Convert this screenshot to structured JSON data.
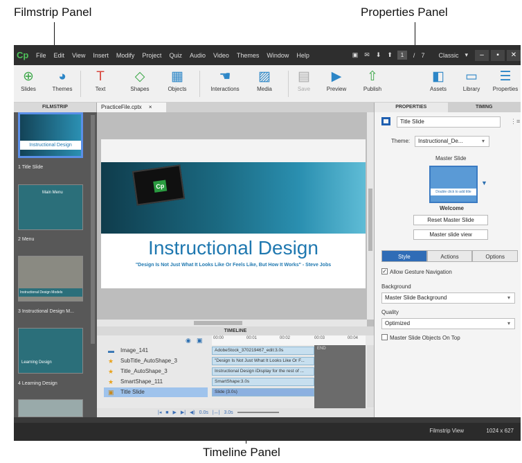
{
  "callouts": {
    "filmstrip": "Filmstrip Panel",
    "properties": "Properties Panel",
    "timeline": "Timeline Panel"
  },
  "menubar": {
    "logo": "Cp",
    "items": [
      "File",
      "Edit",
      "View",
      "Insert",
      "Modify",
      "Project",
      "Quiz",
      "Audio",
      "Video",
      "Themes",
      "Window",
      "Help"
    ],
    "page_current": "1",
    "page_sep": "/",
    "page_total": "7",
    "workspace": "Classic",
    "workspace_icon": "dropdown-icon"
  },
  "toolbar": {
    "slides": "Slides",
    "themes": "Themes",
    "text": "Text",
    "shapes": "Shapes",
    "objects": "Objects",
    "interactions": "Interactions",
    "media": "Media",
    "save": "Save",
    "preview": "Preview",
    "publish": "Publish",
    "assets": "Assets",
    "library": "Library",
    "properties": "Properties"
  },
  "filmstrip": {
    "header": "FILMSTRIP",
    "slides": [
      {
        "label": "1 Title Slide",
        "thumb_text": "Instructional Design"
      },
      {
        "label": "2 Menu",
        "thumb_text": "Main Menu"
      },
      {
        "label": "3 Instructional Design M...",
        "thumb_text": "Instructional Design Models"
      },
      {
        "label": "4 Learning Design",
        "thumb_text": "Learning Design"
      }
    ]
  },
  "document": {
    "tab": "PracticeFile.cptx",
    "close": "×"
  },
  "slide": {
    "logo": "Cp",
    "title": "Instructional Design",
    "subtitle": "\"Design Is Not Just What It Looks Like Or Feels Like, But How It Works\" - Steve Jobs"
  },
  "timeline": {
    "header": "TIMELINE",
    "ticks": [
      "00:00",
      "00:01",
      "00:02",
      "00:03",
      "00:04"
    ],
    "end_label": "END",
    "rows": [
      {
        "name": "Image_141",
        "bar": "AdobeStock_370219467_edit:3.0s"
      },
      {
        "name": "SubTitle_AutoShape_3",
        "bar": "\"Design Is Not Just What It Looks Like Or F..."
      },
      {
        "name": "Title_AutoShape_3",
        "bar": "Instructional Design iDisplay for the rest of ..."
      },
      {
        "name": "SmartShape_111",
        "bar": "SmartShape:3.0s"
      },
      {
        "name": "Title Slide",
        "bar": "Slide (3.0s)"
      }
    ],
    "controls": {
      "time1": "0.0s",
      "time2": "3.0s"
    }
  },
  "properties": {
    "tab_properties": "PROPERTIES",
    "tab_timing": "TIMING",
    "slide_name": "Title Slide",
    "theme_label": "Theme:",
    "theme_value": "Instructional_De...",
    "master_slide_label": "Master Slide",
    "master_thumb_text": "Double click to add title",
    "master_name": "Welcome",
    "reset_button": "Reset Master Slide",
    "view_button": "Master slide view",
    "tab_style": "Style",
    "tab_actions": "Actions",
    "tab_options": "Options",
    "allow_gesture": "Allow Gesture Navigation",
    "background_label": "Background",
    "background_value": "Master Slide Background",
    "quality_label": "Quality",
    "quality_value": "Optimized",
    "master_on_top": "Master Slide Objects On Top"
  },
  "status": {
    "view": "Filmstrip View",
    "size": "1024 x 627"
  }
}
